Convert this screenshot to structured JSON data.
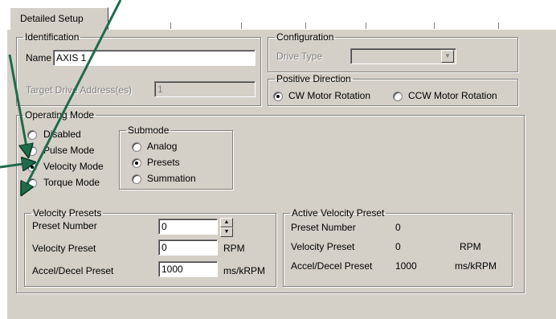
{
  "tab": {
    "label": "Detailed Setup"
  },
  "identification": {
    "legend": "Identification",
    "name_label": "Name",
    "name_value": "AXIS 1",
    "target_label": "Target Drive Address(es)",
    "target_value": "1"
  },
  "configuration": {
    "legend": "Configuration",
    "drive_type_label": "Drive Type",
    "drive_type_value": ""
  },
  "positive_direction": {
    "legend": "Positive Direction",
    "cw_label": "CW Motor Rotation",
    "ccw_label": "CCW Motor Rotation",
    "selected": "cw"
  },
  "operating_mode": {
    "legend": "Operating Mode",
    "options": [
      "Disabled",
      "Pulse Mode",
      "Velocity Mode",
      "Torque Mode"
    ],
    "selected": "Velocity Mode"
  },
  "submode": {
    "legend": "Submode",
    "options": [
      "Analog",
      "Presets",
      "Summation"
    ],
    "selected": "Presets"
  },
  "velocity_presets": {
    "legend": "Velocity Presets",
    "preset_number_label": "Preset Number",
    "preset_number_value": "0",
    "velocity_preset_label": "Velocity Preset",
    "velocity_preset_value": "0",
    "velocity_unit": "RPM",
    "accel_label": "Accel/Decel Preset",
    "accel_value": "1000",
    "accel_unit": "ms/kRPM"
  },
  "active_velocity_preset": {
    "legend": "Active Velocity Preset",
    "preset_number_label": "Preset Number",
    "preset_number_value": "0",
    "velocity_preset_label": "Velocity Preset",
    "velocity_preset_value": "0",
    "velocity_unit": "RPM",
    "accel_label": "Accel/Decel Preset",
    "accel_value": "1000",
    "accel_unit": "ms/kRPM"
  },
  "colors": {
    "panel": "#d4d0c8",
    "annotation_arrow": "#1f6b4a"
  }
}
